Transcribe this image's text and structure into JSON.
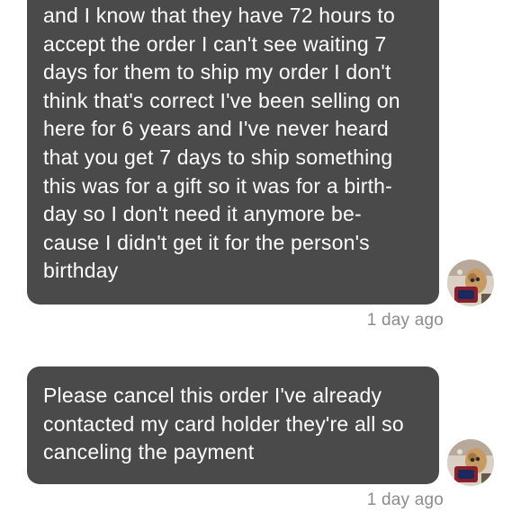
{
  "messages": [
    {
      "text": "and I know that they have 72 hours to\naccept the order I can't see waiting 7\ndays for them to ship my order I don't\nthink that's correct I've been selling on\nhere for 6 years and I've never heard\nthat you get 7 days to ship something\nthis was for a gift so it was for a birth-\nday so I don't need it anymore be-\ncause I didn't get it for the person's\nbirthday",
      "timestamp": "1 day ago"
    },
    {
      "text": "Please cancel this order I've already\ncontacted my card holder they're all so\ncanceling the payment",
      "timestamp": "1 day ago"
    }
  ],
  "colors": {
    "bubble_background": "#4a4a4a",
    "bubble_text": "#ffffff",
    "timestamp_text": "#8c8c8c",
    "page_background": "#ffffff"
  },
  "icons": {
    "sender_avatar": "user-avatar-photo"
  }
}
